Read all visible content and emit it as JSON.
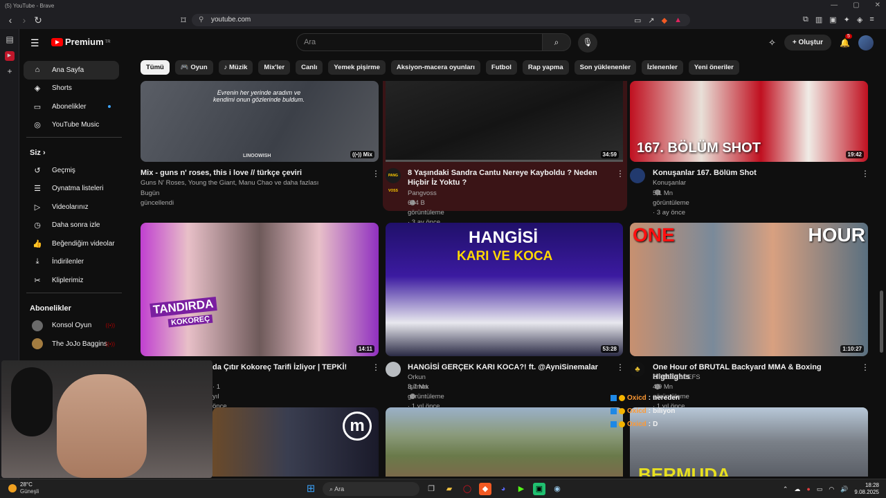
{
  "browser": {
    "window_title": "(5) YouTube - Brave",
    "url": "youtube.com"
  },
  "header": {
    "logo": "Premium",
    "logo_region": "TR",
    "search_placeholder": "Ara",
    "create_label": "Oluştur",
    "notif_count": "5"
  },
  "chips": [
    "Tümü",
    "Oyun",
    "Müzik",
    "Mix'ler",
    "Canlı",
    "Yemek pişirme",
    "Aksiyon-macera oyunları",
    "Futbol",
    "Rap yapma",
    "Son yüklenenler",
    "İzlenenler",
    "Yeni öneriler"
  ],
  "sidebar": {
    "main": [
      {
        "label": "Ana Sayfa",
        "icon": "home-icon"
      },
      {
        "label": "Shorts",
        "icon": "shorts-icon"
      },
      {
        "label": "Abonelikler",
        "icon": "subscriptions-icon"
      },
      {
        "label": "YouTube Music",
        "icon": "music-icon"
      }
    ],
    "you_header": "Siz",
    "you": [
      {
        "label": "Geçmiş",
        "icon": "history-icon"
      },
      {
        "label": "Oynatma listeleri",
        "icon": "playlists-icon"
      },
      {
        "label": "Videolarınız",
        "icon": "your-videos-icon"
      },
      {
        "label": "Daha sonra izle",
        "icon": "watch-later-icon"
      },
      {
        "label": "Beğendiğim videolar",
        "icon": "liked-icon"
      },
      {
        "label": "İndirilenler",
        "icon": "downloads-icon"
      },
      {
        "label": "Kliplerimiz",
        "icon": "clips-icon"
      }
    ],
    "subs_header": "Abonelikler",
    "subs": [
      {
        "label": "Konsol Oyun"
      },
      {
        "label": "The JoJo Baggins"
      }
    ]
  },
  "videos": [
    {
      "title": "Mix - guns n' roses, this i love // türkçe çeviri",
      "channel": "Guns N' Roses, Young the Giant, Manu Chao ve daha fazlası",
      "meta": "Bugün güncellendi",
      "badge": "Mix",
      "overlay": "Evrenin her yerinde aradım ve kendimi onun gözlerinde buldum.",
      "watermark": "LINOOWISH"
    },
    {
      "title": "8 Yaşındaki Sandra Cantu Nereye Kayboldu ? Neden Hiçbir İz Yoktu ?",
      "channel": "Pangvoss",
      "meta": "644 B görüntüleme · 3 ay önce",
      "duration": "34:59",
      "avatar_text": "PANG VOSS"
    },
    {
      "title": "Konuşanlar 167. Bölüm Shot",
      "channel": "Konuşanlar",
      "meta": "5,1 Mn görüntüleme · 3 ay önce",
      "duration": "19:42",
      "overlay": "167. BÖLÜM SHOT"
    },
    {
      "title": "da Çıtır Kokoreç Tarifi İzliyor | TEPKİ!",
      "channel": "",
      "meta": "· 1 yıl önce",
      "duration": "14:11",
      "overlay": "TANDIRDA",
      "overlay2": "KOKOREÇ"
    },
    {
      "title": "HANGİSİ GERÇEK KARI KOCA?! ft. @AyniSinemalar",
      "channel": "Orkun Işıtmak",
      "meta": "3,7 Mn görüntüleme · 1 yıl önce",
      "duration": "53:28",
      "overlay": "HANGİSİ",
      "overlay2": "KARI VE KOCA"
    },
    {
      "title": "One Hour of BRUTAL Backyard MMA & Boxing Highlights",
      "channel": "STREETBEEFS",
      "meta": "4,9 Mn görüntüleme · 1 yıl önce",
      "duration": "1:10:27",
      "overlay": "ONE",
      "overlay2": "HOUR"
    },
    {
      "overlay": "BERMUDA"
    }
  ],
  "chat": [
    {
      "user": "Oxicd",
      "msg": "nereden"
    },
    {
      "user": "Oxicd",
      "msg": "biliyon"
    },
    {
      "user": "Oxicd",
      "msg": "D"
    }
  ],
  "taskbar": {
    "temp": "28°C",
    "weather": "Güneşli",
    "search": "Ara",
    "time": "18:28",
    "date": "9.08.2025"
  }
}
